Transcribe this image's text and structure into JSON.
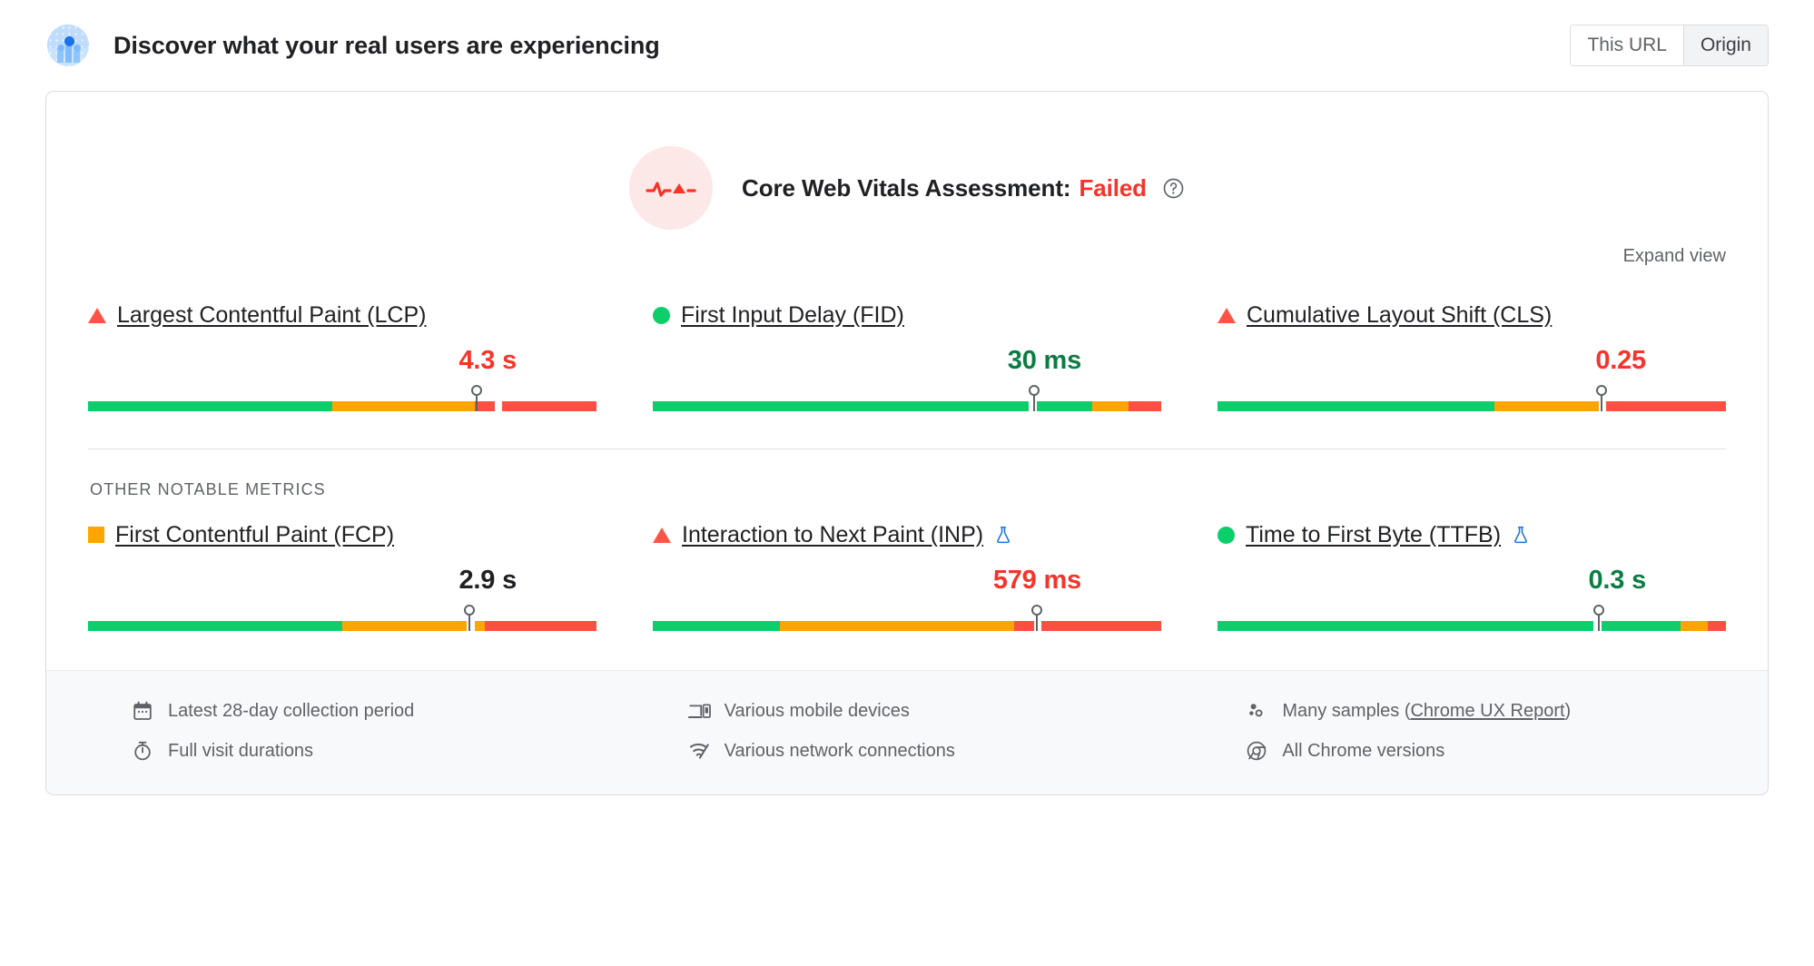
{
  "header": {
    "title": "Discover what your real users are experiencing",
    "icon": "users-chart-icon",
    "toggle": {
      "options": [
        {
          "label": "This URL",
          "selected": true
        },
        {
          "label": "Origin",
          "selected": false
        }
      ]
    }
  },
  "assessment": {
    "icon": "pulse-alert-icon",
    "label": "Core Web Vitals Assessment:",
    "status": "Failed",
    "status_color": "#f5342a",
    "help_icon": "help-circle-icon"
  },
  "expand": {
    "label": "Expand view"
  },
  "section": {
    "other_metrics_title": "OTHER NOTABLE METRICS"
  },
  "colors": {
    "good": "#0cce6b",
    "average": "#ffa400",
    "poor": "#ff4e42",
    "good_text": "#0a7d42",
    "average_text": "#d47e05",
    "poor_text": "#f5342a"
  },
  "core_metrics": [
    {
      "name": "Largest Contentful Paint (LCP)",
      "marker": "triangle",
      "rating": "poor",
      "value": "4.3 s",
      "experimental": false,
      "bar": [
        {
          "color": "good",
          "pct": 48
        },
        {
          "color": "average",
          "pct": 28
        },
        {
          "color": "poor",
          "pct": 4
        },
        {
          "color": "gap",
          "pct": 1.5
        },
        {
          "color": "poor",
          "pct": 18.5
        }
      ],
      "pin_pct": 76.5
    },
    {
      "name": "First Input Delay (FID)",
      "marker": "dot",
      "rating": "good",
      "value": "30 ms",
      "experimental": false,
      "bar": [
        {
          "color": "good",
          "pct": 74
        },
        {
          "color": "gap",
          "pct": 1.5
        },
        {
          "color": "good",
          "pct": 11
        },
        {
          "color": "average",
          "pct": 7
        },
        {
          "color": "poor",
          "pct": 6.5
        }
      ],
      "pin_pct": 75
    },
    {
      "name": "Cumulative Layout Shift (CLS)",
      "marker": "triangle",
      "rating": "poor",
      "value": "0.25",
      "experimental": false,
      "bar": [
        {
          "color": "good",
          "pct": 54.5
        },
        {
          "color": "average",
          "pct": 20.5
        },
        {
          "color": "gap",
          "pct": 1.5
        },
        {
          "color": "poor",
          "pct": 23.5
        }
      ],
      "pin_pct": 75.5
    }
  ],
  "other_metrics": [
    {
      "name": "First Contentful Paint (FCP)",
      "marker": "square",
      "rating": "average",
      "value": "2.9 s",
      "experimental": false,
      "bar": [
        {
          "color": "good",
          "pct": 50
        },
        {
          "color": "average",
          "pct": 24.5
        },
        {
          "color": "gap",
          "pct": 1.5
        },
        {
          "color": "average",
          "pct": 2
        },
        {
          "color": "poor",
          "pct": 22
        }
      ],
      "pin_pct": 75
    },
    {
      "name": "Interaction to Next Paint (INP)",
      "marker": "triangle",
      "rating": "poor",
      "value": "579 ms",
      "experimental": true,
      "experimental_icon": "flask-icon",
      "bar": [
        {
          "color": "good",
          "pct": 25
        },
        {
          "color": "average",
          "pct": 46
        },
        {
          "color": "poor",
          "pct": 4
        },
        {
          "color": "gap",
          "pct": 1.5
        },
        {
          "color": "poor",
          "pct": 23.5
        }
      ],
      "pin_pct": 75.5
    },
    {
      "name": "Time to First Byte (TTFB)",
      "marker": "dot",
      "rating": "good",
      "value": "0.3 s",
      "experimental": true,
      "experimental_icon": "flask-icon",
      "bar": [
        {
          "color": "good",
          "pct": 74
        },
        {
          "color": "gap",
          "pct": 1.5
        },
        {
          "color": "good",
          "pct": 15.5
        },
        {
          "color": "average",
          "pct": 5.5
        },
        {
          "color": "poor",
          "pct": 3.5
        }
      ],
      "pin_pct": 75
    }
  ],
  "footer": {
    "columns": [
      [
        {
          "icon": "calendar-icon",
          "text": "Latest 28-day collection period",
          "link": null
        },
        {
          "icon": "stopwatch-icon",
          "text": "Full visit durations",
          "link": null
        }
      ],
      [
        {
          "icon": "devices-icon",
          "text": "Various mobile devices",
          "link": null
        },
        {
          "icon": "network-signal-icon",
          "text": "Various network connections",
          "link": null
        }
      ],
      [
        {
          "icon": "samples-dots-icon",
          "text_before": "Many samples (",
          "link": "Chrome UX Report",
          "text_after": ")"
        },
        {
          "icon": "chrome-icon",
          "text": "All Chrome versions",
          "link": null
        }
      ]
    ]
  }
}
